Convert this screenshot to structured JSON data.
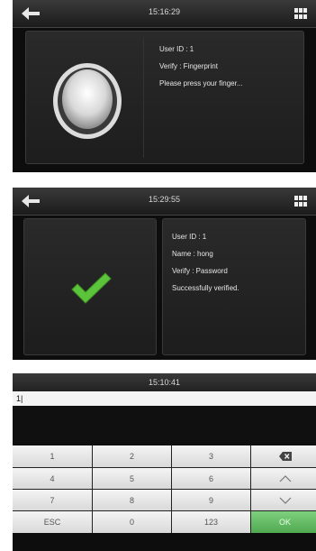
{
  "screen1": {
    "time": "15:16:29",
    "user_id": "User ID : 1",
    "verify": "Verify : Fingerprint",
    "prompt": "Please press your finger..."
  },
  "screen2": {
    "time": "15:29:55",
    "user_id": "User ID : 1",
    "name": "Name : hong",
    "verify": "Verify : Password",
    "result": "Successfully verified."
  },
  "screen3": {
    "time": "15:10:41",
    "input_value": "1|",
    "keys": {
      "k1": "1",
      "k2": "2",
      "k3": "3",
      "k4": "4",
      "k5": "5",
      "k6": "6",
      "k7": "7",
      "k8": "8",
      "k9": "9",
      "esc": "ESC",
      "k0": "0",
      "mode": "123",
      "ok": "OK"
    }
  },
  "icons": [
    "back-arrow-icon",
    "menu-grid-icon",
    "fingerprint-sensor-icon",
    "checkmark-icon",
    "backspace-icon",
    "chevron-up-icon",
    "chevron-down-icon"
  ],
  "colors": {
    "check_green": "#5cc43a",
    "ok_green": "#5db55d"
  }
}
